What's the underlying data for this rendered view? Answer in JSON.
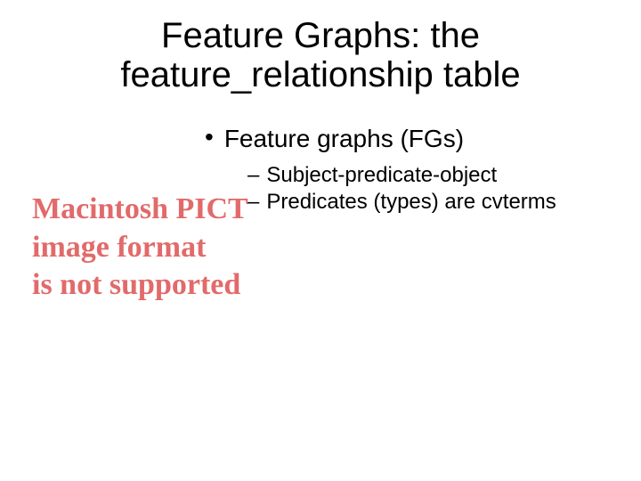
{
  "title": "Feature Graphs: the feature_relationship table",
  "bullet": "Feature graphs (FGs)",
  "sub1_dash": "–",
  "sub1_text": "Subject-predicate-object",
  "sub2_dash": "–",
  "sub2_text": "Predicates (types) are cvterms",
  "bullet_marker": "•",
  "pict_line1": "Macintosh PICT",
  "pict_line2": "image format",
  "pict_line3": "is not supported"
}
